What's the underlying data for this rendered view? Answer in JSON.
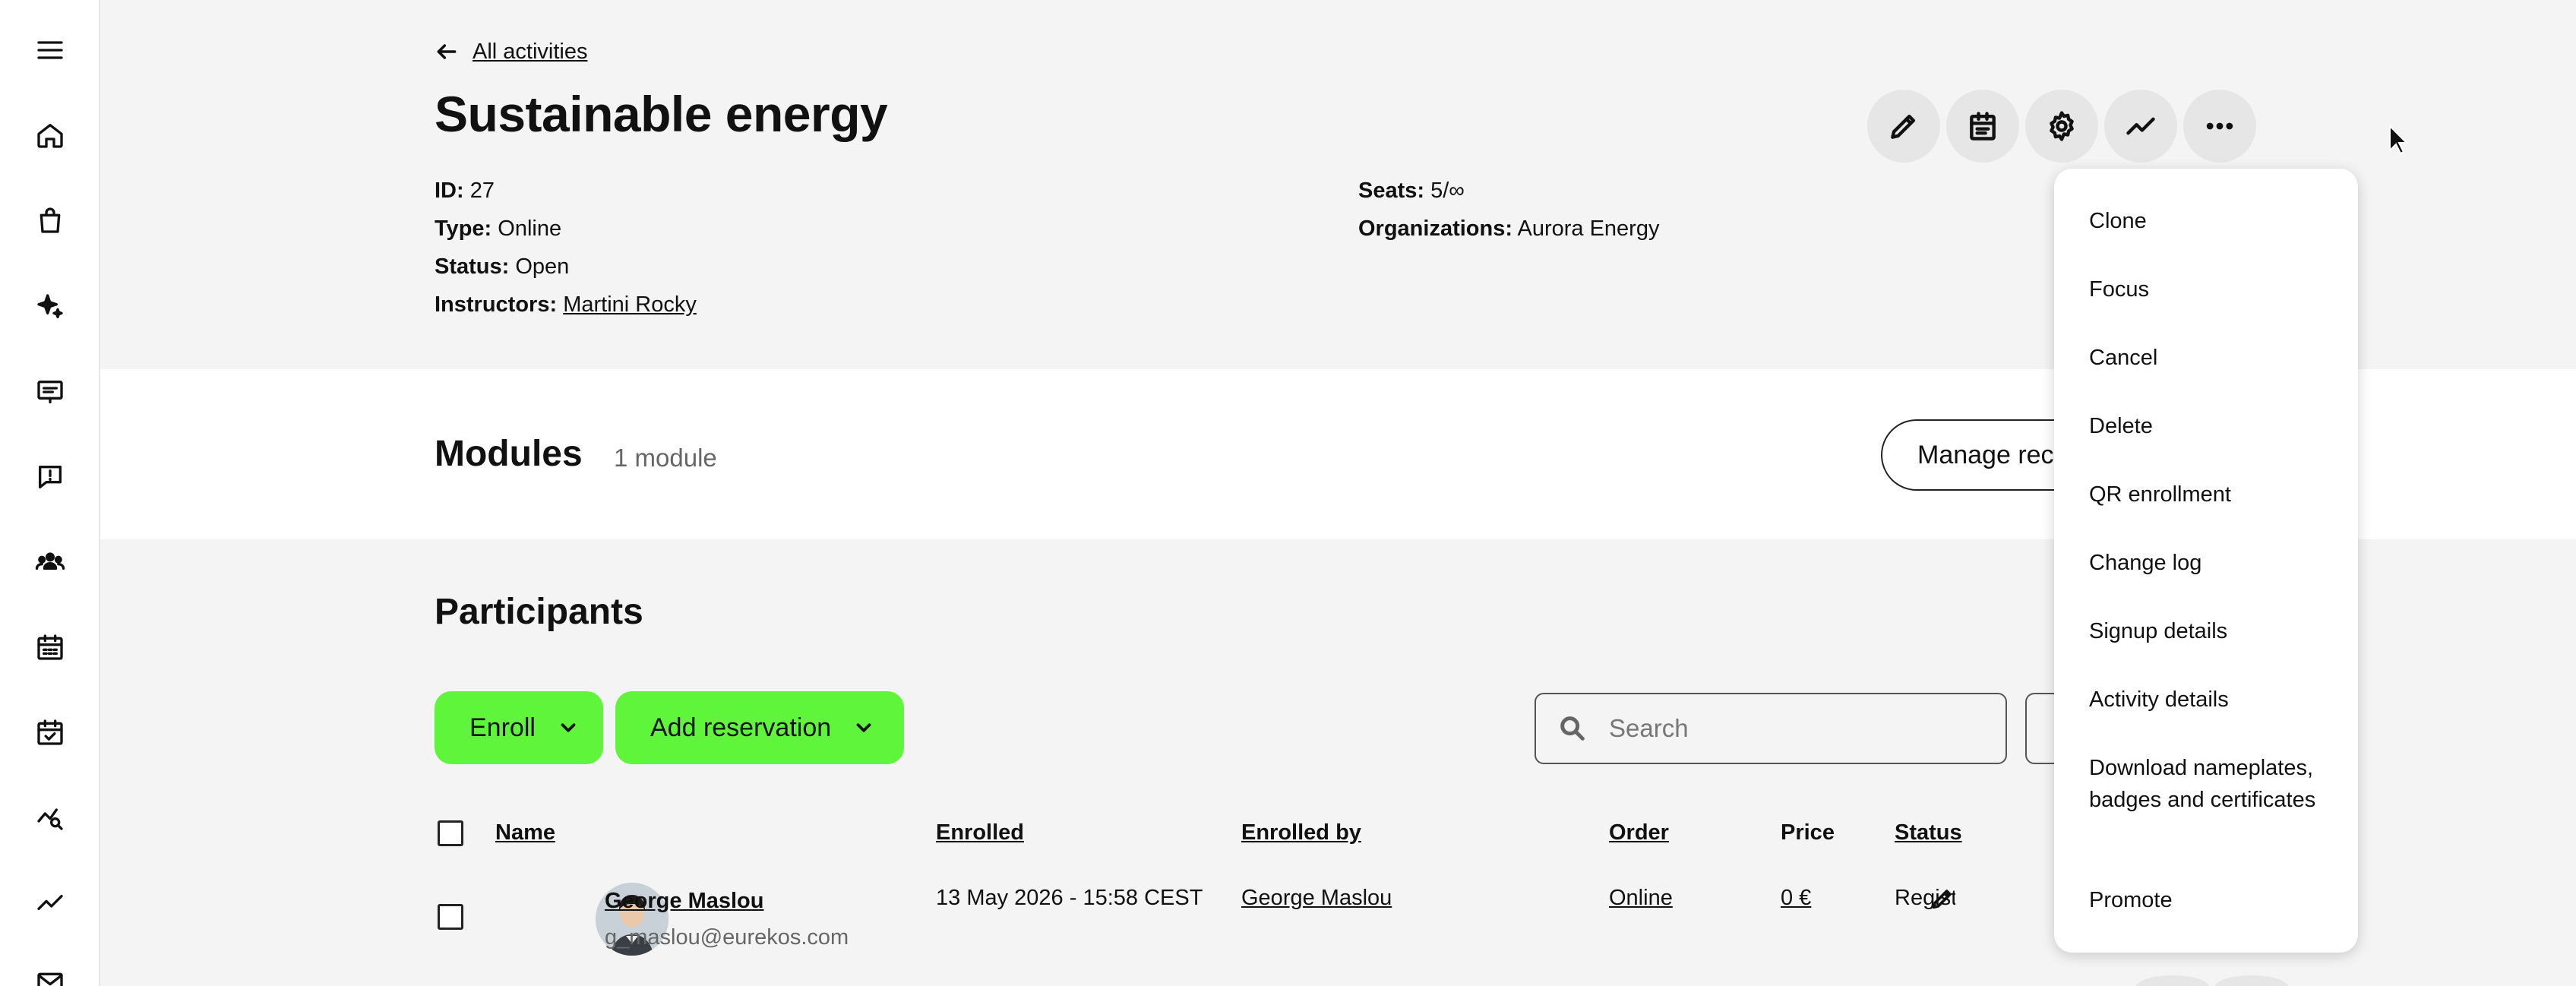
{
  "nav": {
    "back_label": "All activities"
  },
  "activity": {
    "title": "Sustainable energy",
    "details_left": [
      {
        "label": "ID:",
        "value": "27",
        "is_link": false
      },
      {
        "label": "Type:",
        "value": "Online",
        "is_link": false
      },
      {
        "label": "Status:",
        "value": "Open",
        "is_link": false
      },
      {
        "label": "Instructors:",
        "value": "Martini Rocky",
        "is_link": true
      }
    ],
    "details_right": [
      {
        "label": "Seats:",
        "value": "5/∞"
      },
      {
        "label": "Organizations:",
        "value": "Aurora Energy"
      }
    ]
  },
  "toolbar": {
    "icons": [
      "pencil-icon",
      "calendar-icon",
      "gear-icon",
      "trend-icon",
      "more-icon"
    ]
  },
  "modules": {
    "title": "Modules",
    "count": "1 module",
    "manage_button": "Manage recurrence"
  },
  "participants": {
    "title": "Participants",
    "enroll_button": "Enroll",
    "add_reservation_button": "Add reservation",
    "search_placeholder": "Search",
    "columns": [
      "Name",
      "Enrolled",
      "Enrolled by",
      "Order",
      "Price",
      "Status"
    ],
    "rows": [
      {
        "name": "George Maslou",
        "email": "g_maslou@eurekos.com",
        "enrolled": "13 May 2026 - 15:58 CEST",
        "enrolled_by": "George Maslou",
        "order": "Online",
        "price": "0 €",
        "status": "Registered"
      }
    ]
  },
  "menu": {
    "items": [
      "Clone",
      "Focus",
      "Cancel",
      "Delete",
      "QR enrollment",
      "Change log",
      "Signup details",
      "Activity details",
      "Download nameplates, badges and certificates",
      "Promote"
    ]
  },
  "colors": {
    "accent_green": "#5ff53a",
    "background": "#f4f4f4",
    "tool_button": "#e6e6e6"
  }
}
